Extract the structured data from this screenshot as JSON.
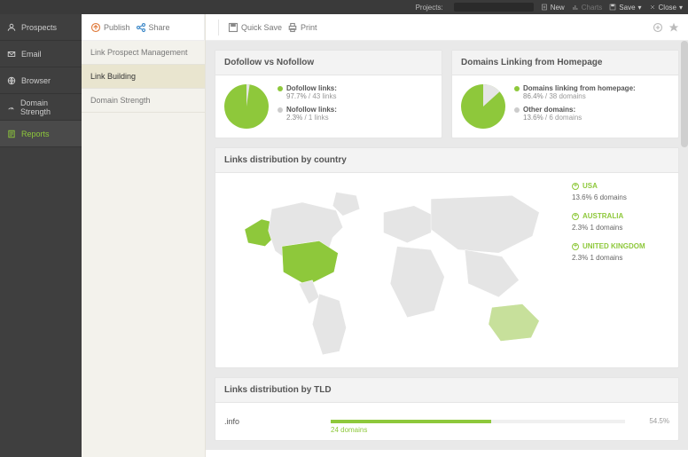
{
  "topbar": {
    "projects_label": "Projects:",
    "new": "New",
    "charts": "Charts",
    "save": "Save",
    "close": "Close"
  },
  "sidebar": {
    "items": [
      {
        "label": "Prospects"
      },
      {
        "label": "Email"
      },
      {
        "label": "Browser"
      },
      {
        "label": "Domain Strength"
      },
      {
        "label": "Reports"
      }
    ]
  },
  "subnav": {
    "items": [
      {
        "label": "Link Prospect Management"
      },
      {
        "label": "Link Building"
      },
      {
        "label": "Domain Strength"
      }
    ]
  },
  "toolbar": {
    "publish": "Publish",
    "share": "Share",
    "quicksave": "Quick Save",
    "print": "Print"
  },
  "cards": {
    "dofollow": {
      "title": "Dofollow vs Nofollow",
      "series": [
        {
          "label": "Dofollow links:",
          "pct": "97.7%",
          "extra": " / 43 links"
        },
        {
          "label": "Nofollow links:",
          "pct": "2.3%",
          "extra": " / 1 links"
        }
      ]
    },
    "homepage": {
      "title": "Domains Linking from Homepage",
      "series": [
        {
          "label": "Domains linking from homepage:",
          "pct": "86.4%",
          "extra": " / 38 domains"
        },
        {
          "label": "Other domains:",
          "pct": "13.6%",
          "extra": " / 6 domains"
        }
      ]
    }
  },
  "map_card": {
    "title": "Links distribution by country",
    "countries": [
      {
        "name": "USA",
        "stat": "13.6% 6 domains"
      },
      {
        "name": "AUSTRALIA",
        "stat": "2.3% 1 domains"
      },
      {
        "name": "UNITED KINGDOM",
        "stat": "2.3% 1 domains"
      }
    ]
  },
  "tld_card": {
    "title": "Links distribution by TLD",
    "rows": [
      {
        "tld": ".info",
        "count": "24 domains",
        "pct": "54.5%"
      }
    ]
  },
  "chart_data": [
    {
      "type": "pie",
      "title": "Dofollow vs Nofollow",
      "series": [
        {
          "name": "Dofollow links",
          "value": 97.7,
          "count": 43,
          "color": "#8ec83b"
        },
        {
          "name": "Nofollow links",
          "value": 2.3,
          "count": 1,
          "color": "#e5e5e5"
        }
      ]
    },
    {
      "type": "pie",
      "title": "Domains Linking from Homepage",
      "series": [
        {
          "name": "Domains linking from homepage",
          "value": 86.4,
          "count": 38,
          "color": "#8ec83b"
        },
        {
          "name": "Other domains",
          "value": 13.6,
          "count": 6,
          "color": "#e5e5e5"
        }
      ]
    },
    {
      "type": "map",
      "title": "Links distribution by country",
      "data": [
        {
          "country": "USA",
          "pct": 13.6,
          "domains": 6
        },
        {
          "country": "AUSTRALIA",
          "pct": 2.3,
          "domains": 1
        },
        {
          "country": "UNITED KINGDOM",
          "pct": 2.3,
          "domains": 1
        }
      ]
    },
    {
      "type": "bar",
      "title": "Links distribution by TLD",
      "categories": [
        ".info"
      ],
      "values": [
        54.5
      ],
      "counts": [
        24
      ],
      "xlabel": "",
      "ylabel": "",
      "ylim": [
        0,
        100
      ]
    }
  ]
}
